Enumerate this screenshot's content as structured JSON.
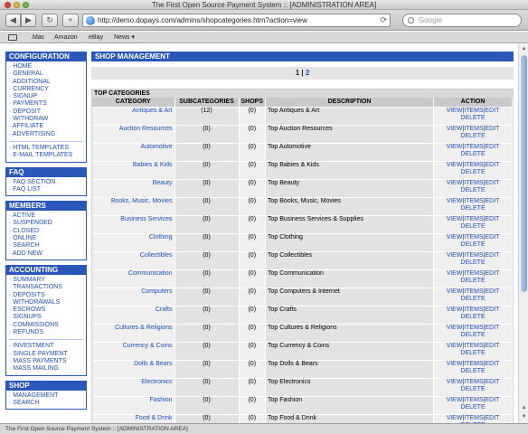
{
  "window": {
    "title": "The First Open Source Payment System :: [ADMINISTRATION AREA]"
  },
  "toolbar": {
    "url": "http://demo.dopays.com/admins/shopcategories.htm?action=view",
    "search_placeholder": "Google"
  },
  "bookmarks": [
    ".Mac",
    "Amazon",
    "eBay",
    "News ▾"
  ],
  "sidebar": {
    "sections": [
      {
        "title": "CONFIGURATION",
        "groups": [
          [
            "HOME",
            "GENERAL",
            "ADDITIONAL",
            "CURRENCY",
            "SIGNUP",
            "PAYMENTS",
            "DEPOSIT",
            "WITHDRAW",
            "AFFILIATE",
            "ADVERTISING"
          ],
          [
            "HTML TEMPLATES",
            "E-MAIL TEMPLATES"
          ]
        ]
      },
      {
        "title": "FAQ",
        "groups": [
          [
            "FAQ SECTION",
            "FAQ LIST"
          ]
        ]
      },
      {
        "title": "MEMBERS",
        "groups": [
          [
            "ACTIVE",
            "SUSPENDED",
            "CLOSED",
            "ONLINE",
            "SEARCH",
            "ADD NEW"
          ]
        ]
      },
      {
        "title": "ACCOUNTING",
        "groups": [
          [
            "SUMMARY",
            "TRANSACTIONS",
            "DEPOSITS",
            "WITHDRAWALS",
            "ESCROWS",
            "SIGNUPS",
            "COMMISSIONS",
            "REFUNDS"
          ],
          [
            "INVESTMENT",
            "SINGLE PAYMENT",
            "MASS PAYMENTS",
            "MASS MAILING"
          ]
        ]
      },
      {
        "title": "SHOP",
        "groups": [
          [
            "MANAGEMENT",
            "SEARCH"
          ]
        ]
      }
    ]
  },
  "main": {
    "title": "SHOP MANAGEMENT",
    "pager": {
      "current": "1",
      "separator": " | ",
      "next": "2"
    },
    "panel_title": "TOP CATEGORIES",
    "columns": [
      "CATEGORY",
      "SUBCATEGORIES",
      "SHOPS",
      "DESCRIPTION",
      "ACTION"
    ],
    "actions": {
      "view": "VIEW",
      "items": "ITEMS",
      "edit": "EDIT",
      "delete": "DELETE",
      "sep": "|"
    },
    "rows": [
      {
        "category": "Antiques & Art",
        "sub": "(12)",
        "shops": "(0)",
        "desc": "Top Antiques & Art"
      },
      {
        "category": "Auction Resources",
        "sub": "(0)",
        "shops": "(0)",
        "desc": "Top Auction Resources"
      },
      {
        "category": "Automotive",
        "sub": "(0)",
        "shops": "(0)",
        "desc": "Top Automotive"
      },
      {
        "category": "Babies & Kids",
        "sub": "(0)",
        "shops": "(0)",
        "desc": "Top Babies & Kids"
      },
      {
        "category": "Beauty",
        "sub": "(0)",
        "shops": "(0)",
        "desc": "Top Beauty"
      },
      {
        "category": "Books, Music, Movies",
        "sub": "(0)",
        "shops": "(0)",
        "desc": "Top Books, Music, Movies"
      },
      {
        "category": "Business Services",
        "sub": "(0)",
        "shops": "(0)",
        "desc": "Top Business Services & Supplies"
      },
      {
        "category": "Clothing",
        "sub": "(0)",
        "shops": "(0)",
        "desc": "Top Clothing"
      },
      {
        "category": "Collectibles",
        "sub": "(0)",
        "shops": "(0)",
        "desc": "Top Collectibles"
      },
      {
        "category": "Communication",
        "sub": "(0)",
        "shops": "(0)",
        "desc": "Top Communication"
      },
      {
        "category": "Computers",
        "sub": "(0)",
        "shops": "(0)",
        "desc": "Top Computers & Internet"
      },
      {
        "category": "Crafts",
        "sub": "(0)",
        "shops": "(0)",
        "desc": "Top Crafts"
      },
      {
        "category": "Cultures & Religions",
        "sub": "(0)",
        "shops": "(0)",
        "desc": "Top Cultures & Religions"
      },
      {
        "category": "Currency & Coins",
        "sub": "(0)",
        "shops": "(0)",
        "desc": "Top Currency & Coins"
      },
      {
        "category": "Dolls & Bears",
        "sub": "(0)",
        "shops": "(0)",
        "desc": "Top Dolls & Bears"
      },
      {
        "category": "Electronics",
        "sub": "(0)",
        "shops": "(0)",
        "desc": "Top Electronics"
      },
      {
        "category": "Fashion",
        "sub": "(0)",
        "shops": "(0)",
        "desc": "Top Fashion"
      },
      {
        "category": "Food & Drink",
        "sub": "(0)",
        "shops": "(0)",
        "desc": "Top Food & Drink"
      }
    ]
  },
  "status": {
    "text": "The First Open Source Payment System :: [ADMINISTRATION AREA]"
  },
  "colors": {
    "accent": "#2a57b8",
    "link": "#1f4fbf"
  }
}
